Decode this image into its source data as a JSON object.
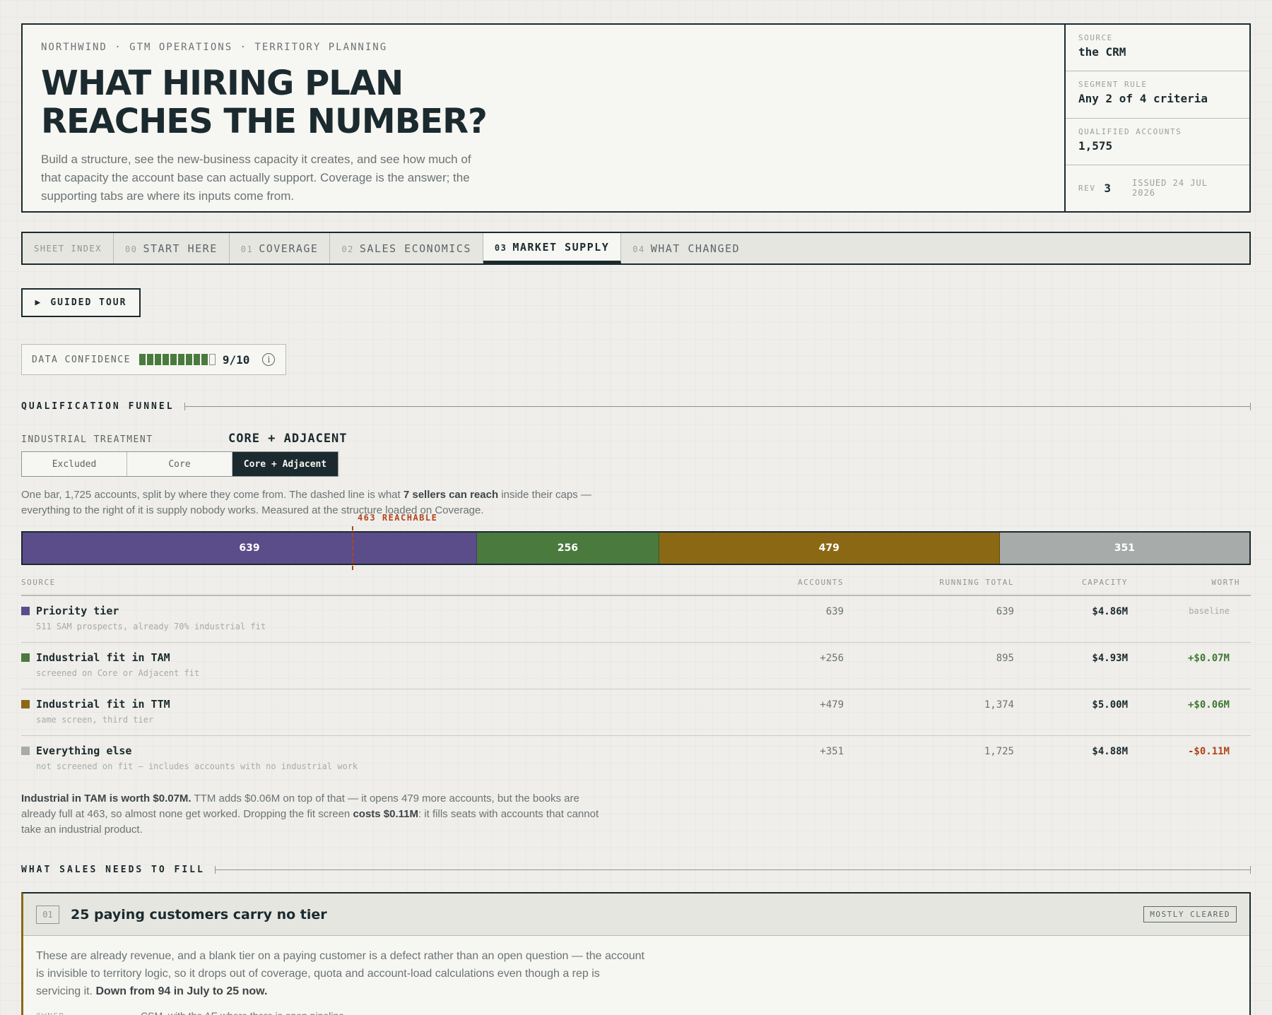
{
  "header": {
    "eyebrow": "NORTHWIND · GTM OPERATIONS · TERRITORY PLANNING",
    "title": "WHAT HIRING PLAN REACHES THE NUMBER?",
    "subtitle": "Build a structure, see the new-business capacity it creates, and see how much of that capacity the account base can actually support. Coverage is the answer; the supporting tabs are where its inputs come from.",
    "meta": [
      {
        "label": "SOURCE",
        "value": "the CRM"
      },
      {
        "label": "SEGMENT RULE",
        "value": "Any 2 of 4 criteria"
      },
      {
        "label": "QUALIFIED ACCOUNTS",
        "value": "1,575"
      }
    ],
    "rev_label": "REV",
    "rev": "3",
    "issued": "ISSUED 24 JUL 2026"
  },
  "tabs": {
    "index_label": "SHEET INDEX",
    "items": [
      {
        "num": "00",
        "label": "START HERE"
      },
      {
        "num": "01",
        "label": "COVERAGE"
      },
      {
        "num": "02",
        "label": "SALES ECONOMICS"
      },
      {
        "num": "03",
        "label": "MARKET SUPPLY"
      },
      {
        "num": "04",
        "label": "WHAT CHANGED"
      }
    ],
    "active": 3
  },
  "tour": {
    "icon": "▶",
    "label": "GUIDED TOUR"
  },
  "confidence": {
    "label": "DATA CONFIDENCE",
    "level": 9,
    "max": 10,
    "score": "9/10",
    "info_icon": "i"
  },
  "funnel": {
    "heading": "QUALIFICATION FUNNEL",
    "treatment_label": "INDUSTRIAL TREATMENT",
    "treatment_current": "CORE + ADJACENT",
    "options": [
      "Excluded",
      "Core",
      "Core + Adjacent"
    ],
    "selected": 2,
    "desc_a": "One bar, 1,725 accounts, split by where they come from. The dashed line is what ",
    "desc_b": "7 sellers can reach",
    "desc_c": " inside their caps — everything to the right of it is supply nobody works. Measured at the structure loaded on Coverage.",
    "reach_label": "463 REACHABLE",
    "reach_value": 463,
    "total": 1725,
    "segments": [
      {
        "value": 639,
        "label": "639",
        "color": "#5b4d8a"
      },
      {
        "value": 256,
        "label": "256",
        "color": "#4a7a3e"
      },
      {
        "value": 479,
        "label": "479",
        "color": "#8b6914"
      },
      {
        "value": 351,
        "label": "351",
        "color": "#a7aba9"
      }
    ]
  },
  "table": {
    "headers": {
      "source": "SOURCE",
      "accounts": "ACCOUNTS",
      "running": "RUNNING TOTAL",
      "capacity": "CAPACITY",
      "worth": "WORTH"
    },
    "rows": [
      {
        "name": "Priority tier",
        "sub": "511 SAM prospects, already 70% industrial fit",
        "accounts": "639",
        "running": "639",
        "capacity": "$4.86M",
        "worth": "baseline",
        "color": "#5b4d8a"
      },
      {
        "name": "Industrial fit in TAM",
        "sub": "screened on Core or Adjacent fit",
        "accounts": "+256",
        "running": "895",
        "capacity": "$4.93M",
        "worth": "+$0.07M",
        "color": "#4a7a3e"
      },
      {
        "name": "Industrial fit in TTM",
        "sub": "same screen, third tier",
        "accounts": "+479",
        "running": "1,374",
        "capacity": "$5.00M",
        "worth": "+$0.06M",
        "color": "#8b6914"
      },
      {
        "name": "Everything else",
        "sub": "not screened on fit — includes accounts with no industrial work",
        "accounts": "+351",
        "running": "1,725",
        "capacity": "$4.88M",
        "worth": "-$0.11M",
        "color": "#a7aba9"
      }
    ]
  },
  "summary": {
    "a": "Industrial in TAM is worth $0.07M.",
    "b": " TTM adds $0.06M on top of that — it opens 479 more accounts, but the books are already full at 463, so almost none get worked. Dropping the fit screen ",
    "c": "costs $0.11M",
    "d": ": it fills seats with accounts that cannot take an industrial product."
  },
  "sales": {
    "heading": "WHAT SALES NEEDS TO FILL",
    "card": {
      "num": "01",
      "title": "25 paying customers carry no tier",
      "badge": "MOSTLY CLEARED",
      "body_a": "These are already revenue, and a blank tier on a paying customer is a defect rather than an open question — the account is invisible to territory logic, so it drops out of coverage, quota and account-load calculations even though a rep is servicing it. ",
      "body_b": "Down from 94 in July to 25 now.",
      "owner_label": "OWNER",
      "owner": "CSM, with the AE where there is open pipeline"
    }
  }
}
